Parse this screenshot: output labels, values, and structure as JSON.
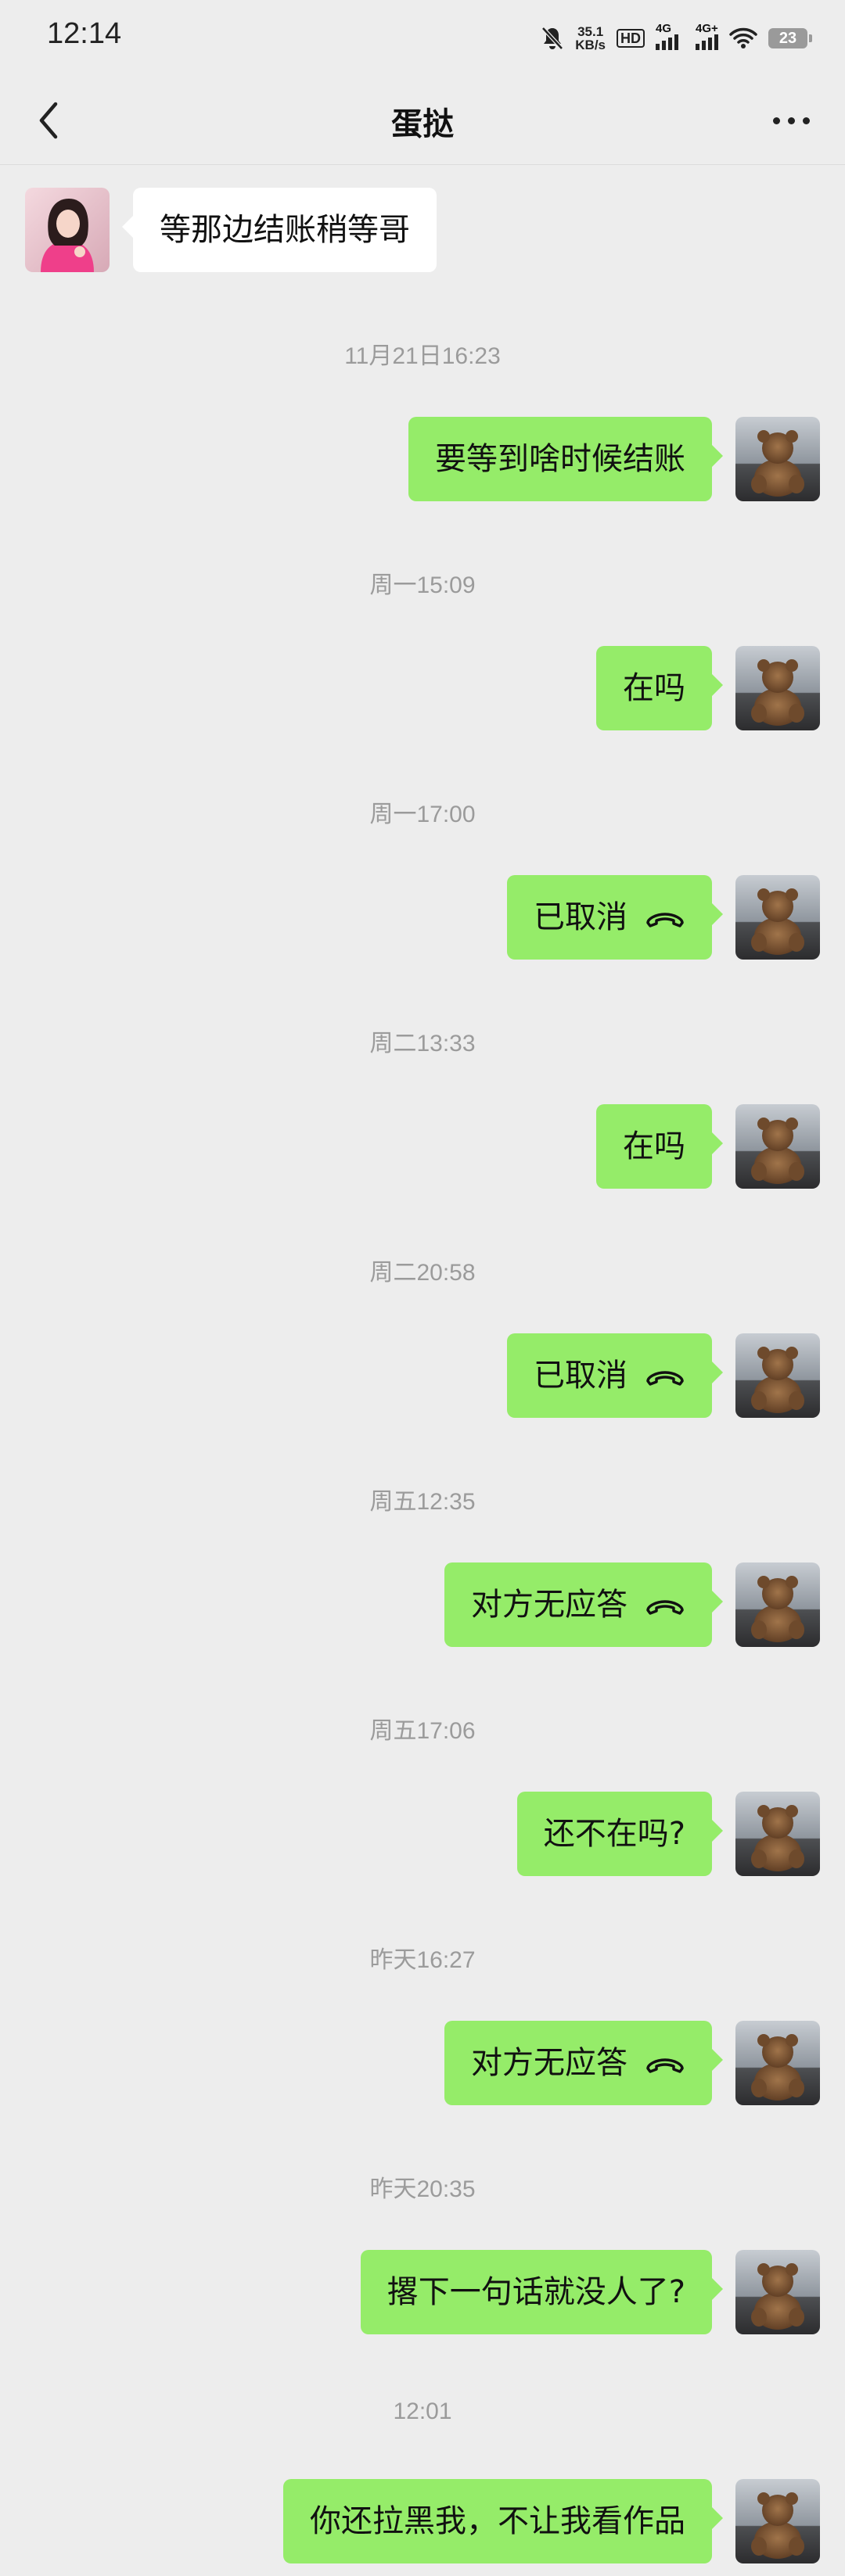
{
  "status_bar": {
    "time": "12:14",
    "net_speed_value": "35.1",
    "net_speed_unit": "KB/s",
    "hd_label": "HD",
    "sim1_label": "4G",
    "sim2_label": "4G+",
    "battery": "23"
  },
  "header": {
    "title": "蛋挞"
  },
  "messages": [
    {
      "type": "in",
      "text": "等那边结账稍等哥"
    },
    {
      "type": "time",
      "text": "11月21日16:23"
    },
    {
      "type": "out",
      "text": "要等到啥时候结账"
    },
    {
      "type": "time",
      "text": "周一15:09"
    },
    {
      "type": "out",
      "text": "在吗"
    },
    {
      "type": "time",
      "text": "周一17:00"
    },
    {
      "type": "out",
      "text": "已取消",
      "icon": "call-hangup-icon"
    },
    {
      "type": "time",
      "text": "周二13:33"
    },
    {
      "type": "out",
      "text": "在吗"
    },
    {
      "type": "time",
      "text": "周二20:58"
    },
    {
      "type": "out",
      "text": "已取消",
      "icon": "call-hangup-icon"
    },
    {
      "type": "time",
      "text": "周五12:35"
    },
    {
      "type": "out",
      "text": "对方无应答",
      "icon": "call-hangup-icon"
    },
    {
      "type": "time",
      "text": "周五17:06"
    },
    {
      "type": "out",
      "text": "还不在吗?"
    },
    {
      "type": "time",
      "text": "昨天16:27"
    },
    {
      "type": "out",
      "text": "对方无应答",
      "icon": "call-hangup-icon"
    },
    {
      "type": "time",
      "text": "昨天20:35"
    },
    {
      "type": "out",
      "text": "撂下一句话就没人了?"
    },
    {
      "type": "time",
      "text": "12:01"
    },
    {
      "type": "out",
      "text": "你还拉黑我，不让我看作品"
    }
  ],
  "colors": {
    "background": "#ededed",
    "out_bubble": "#95ec69",
    "in_bubble": "#ffffff",
    "timestamp": "#9b9b9b"
  }
}
